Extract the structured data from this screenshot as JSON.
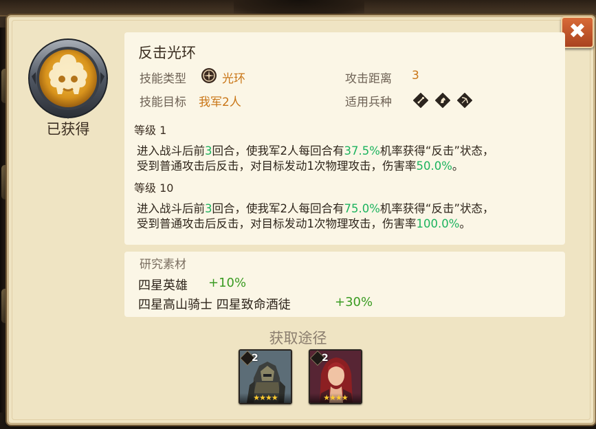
{
  "skill": {
    "name": "反击光环",
    "status": "已获得",
    "type_label": "技能类型",
    "type_value": "光环",
    "type_icon": "aura-icon",
    "target_label": "技能目标",
    "target_value": "我军2人",
    "range_label": "攻击距离",
    "range_value": "3",
    "troops_label": "适用兵种",
    "troop_icons": [
      "sword-icon",
      "horse-icon",
      "bow-icon"
    ]
  },
  "levels": [
    {
      "label": "等级 1",
      "line1": [
        "进入战斗后前",
        "3",
        "回合，使我军2人每回合有",
        "37.5%",
        "机率获得“反击”状态，"
      ],
      "line2": [
        "受到普通攻击后反击，对目标发动1次物理攻击，伤害率",
        "50.0%",
        "。"
      ]
    },
    {
      "label": "等级 10",
      "line1": [
        "进入战斗后前",
        "3",
        "回合，使我军2人每回合有",
        "75.0%",
        "机率获得“反击”状态，"
      ],
      "line2": [
        "受到普通攻击后反击，对目标发动1次物理攻击，伤害率",
        "100.0%",
        "。"
      ]
    }
  ],
  "research": {
    "title": "研究素材",
    "items": [
      {
        "name": "四星英雄",
        "bonus": "+10%"
      },
      {
        "name": "四星高山骑士 四星致命酒徒",
        "bonus": "+30%"
      }
    ]
  },
  "sources": {
    "title": "获取途径",
    "heroes": [
      {
        "badge": "2",
        "stars": "★★★★",
        "class_icon": "sword-icon",
        "portrait": "armored-knight-portrait"
      },
      {
        "badge": "2",
        "stars": "★★★★",
        "class_icon": "horse-icon",
        "portrait": "red-haired-heroine-portrait"
      }
    ]
  },
  "close_label": "✖",
  "colors": {
    "accent_value": "#c97617",
    "highlight": "#1cb35e",
    "bonus": "#3a9b22",
    "panel_bg": "#efe4c3",
    "close_bg": "#c2552a"
  }
}
